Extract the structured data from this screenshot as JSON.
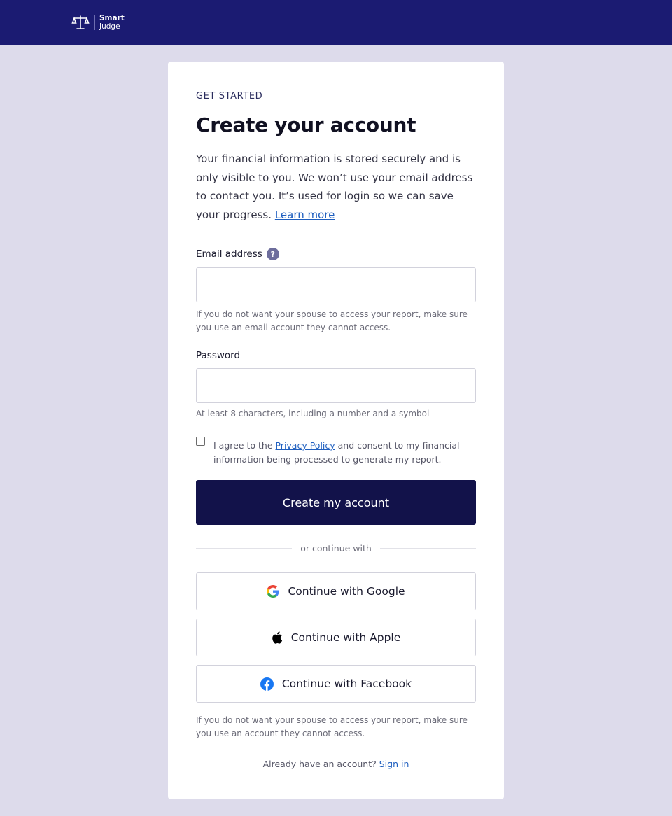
{
  "brand": {
    "line1": "Smart",
    "line2": "Judge"
  },
  "form": {
    "eyebrow": "GET STARTED",
    "title": "Create your account",
    "intro": "Your financial information is stored securely and is only visible to you. We won’t use your email address to contact you. It’s used for login so we can save your progress.",
    "learn_more": "Learn more",
    "email": {
      "label": "Email address",
      "help_icon": "?",
      "value": "",
      "placeholder": "",
      "hint": "If you do not want your spouse to access your report, make sure you use an email account they cannot access."
    },
    "password": {
      "label": "Password",
      "value": "",
      "placeholder": "",
      "hint": "At least 8 characters, including a number and a symbol"
    },
    "consent": {
      "checked": false,
      "prefix": "I agree to the ",
      "link": "Privacy Policy",
      "suffix": " and consent to my financial information being processed to generate my report."
    },
    "submit_label": "Create my account",
    "divider_text": "or continue with",
    "social": [
      {
        "label": "Continue with Google",
        "icon": "google-icon"
      },
      {
        "label": "Continue with Apple",
        "icon": "apple-icon"
      },
      {
        "label": "Continue with Facebook",
        "icon": "facebook-icon"
      }
    ],
    "footer_hint": "If you do not want your spouse to access your report, make sure you use an account they cannot access.",
    "signin_prompt": "Already have an account? ",
    "signin_link": "Sign in"
  },
  "colors": {
    "topbar": "#1b1b72",
    "background": "#dddbeb",
    "primary_button": "#12124a",
    "link": "#1f5fbf"
  }
}
